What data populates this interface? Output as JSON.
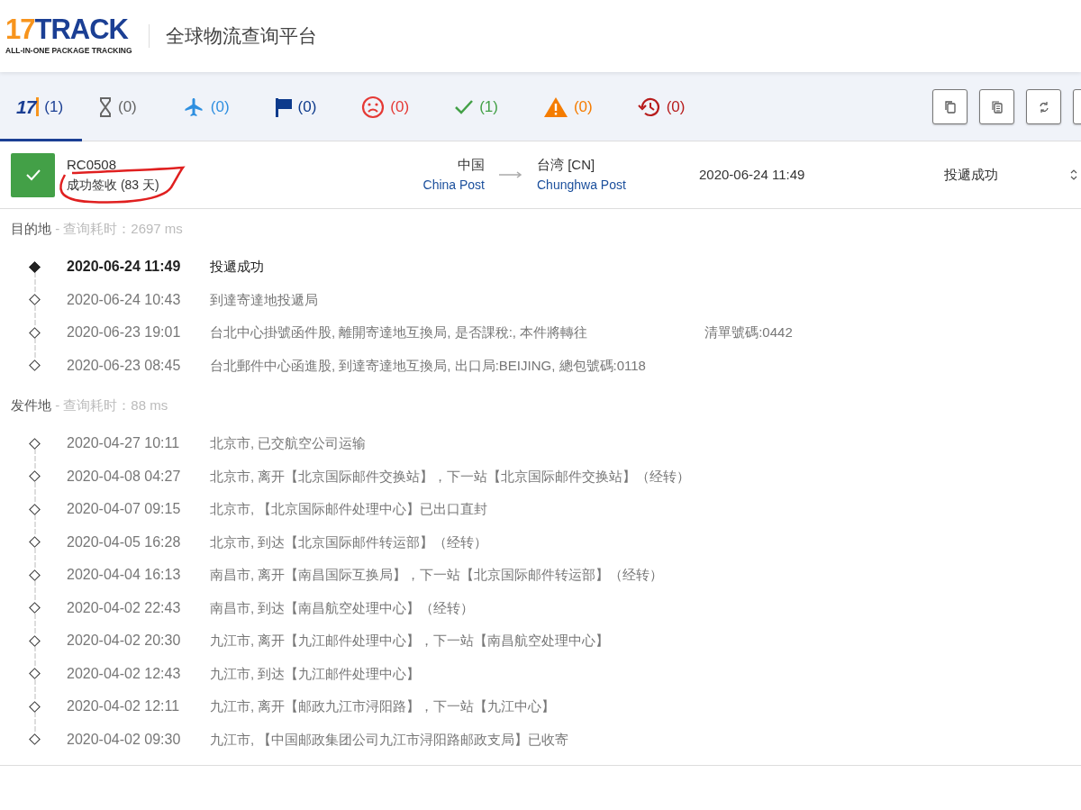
{
  "header": {
    "logo_number": "17",
    "logo_word": "TRACK",
    "logo_tagline": "ALL-IN-ONE PACKAGE TRACKING",
    "title": "全球物流查询平台"
  },
  "tabs": [
    {
      "kind": "all",
      "logo_text": "17",
      "count": "(1)",
      "selected": true
    },
    {
      "kind": "pending",
      "count": "(0)",
      "selected": false
    },
    {
      "kind": "transit",
      "count": "(0)",
      "selected": false
    },
    {
      "kind": "pickup",
      "count": "(0)",
      "selected": false
    },
    {
      "kind": "undelivered",
      "count": "(0)",
      "selected": false
    },
    {
      "kind": "delivered",
      "count": "(1)",
      "selected": false
    },
    {
      "kind": "alert",
      "count": "(0)",
      "selected": false
    },
    {
      "kind": "expired",
      "count": "(0)",
      "selected": false
    }
  ],
  "toolbar": [
    {
      "kind": "copy"
    },
    {
      "kind": "copy-list"
    },
    {
      "kind": "refresh"
    },
    {
      "kind": "more"
    }
  ],
  "shipment": {
    "number": "RC0508",
    "status": "成功签收 (83 天)",
    "origin_country": "中国",
    "origin_carrier": "China Post",
    "dest_country": "台湾 [CN]",
    "dest_carrier": "Chunghwa Post",
    "latest_time": "2020-06-24 11:49",
    "latest_event": "投遞成功"
  },
  "sections": [
    {
      "title": "目的地",
      "timing": " - 查询耗时：2697 ms",
      "events": [
        {
          "time": "2020-06-24 11:49",
          "description": "投遞成功",
          "latest": true
        },
        {
          "time": "2020-06-24 10:43",
          "description": "到達寄達地投遞局",
          "latest": false
        },
        {
          "time": "2020-06-23 19:01",
          "description": "台北中心掛號函件股, 離開寄達地互換局, 是否課稅:, 本件將轉往",
          "description_extra": "清單號碼:0442",
          "latest": false
        },
        {
          "time": "2020-06-23 08:45",
          "description": "台北郵件中心函進股, 到達寄達地互換局, 出口局:BEIJING, 總包號碼:0118",
          "latest": false
        }
      ]
    },
    {
      "title": "发件地",
      "timing": " - 查询耗时：88 ms",
      "events": [
        {
          "time": "2020-04-27 10:11",
          "description": "北京市, 已交航空公司运输",
          "latest": false
        },
        {
          "time": "2020-04-08 04:27",
          "description": "北京市, 离开【北京国际邮件交换站】，下一站【北京国际邮件交换站】（经转）",
          "latest": false
        },
        {
          "time": "2020-04-07 09:15",
          "description": "北京市, 【北京国际邮件处理中心】已出口直封",
          "latest": false
        },
        {
          "time": "2020-04-05 16:28",
          "description": "北京市, 到达【北京国际邮件转运部】（经转）",
          "latest": false
        },
        {
          "time": "2020-04-04 16:13",
          "description": "南昌市, 离开【南昌国际互换局】，下一站【北京国际邮件转运部】（经转）",
          "latest": false
        },
        {
          "time": "2020-04-02 22:43",
          "description": "南昌市, 到达【南昌航空处理中心】（经转）",
          "latest": false
        },
        {
          "time": "2020-04-02 20:30",
          "description": "九江市, 离开【九江邮件处理中心】，下一站【南昌航空处理中心】",
          "latest": false
        },
        {
          "time": "2020-04-02 12:43",
          "description": "九江市, 到达【九江邮件处理中心】",
          "latest": false
        },
        {
          "time": "2020-04-02 12:11",
          "description": "九江市, 离开【邮政九江市浔阳路】，下一站【九江中心】",
          "latest": false
        },
        {
          "time": "2020-04-02 09:30",
          "description": "九江市, 【中国邮政集团公司九江市浔阳路邮政支局】已收寄",
          "latest": false
        }
      ]
    }
  ]
}
